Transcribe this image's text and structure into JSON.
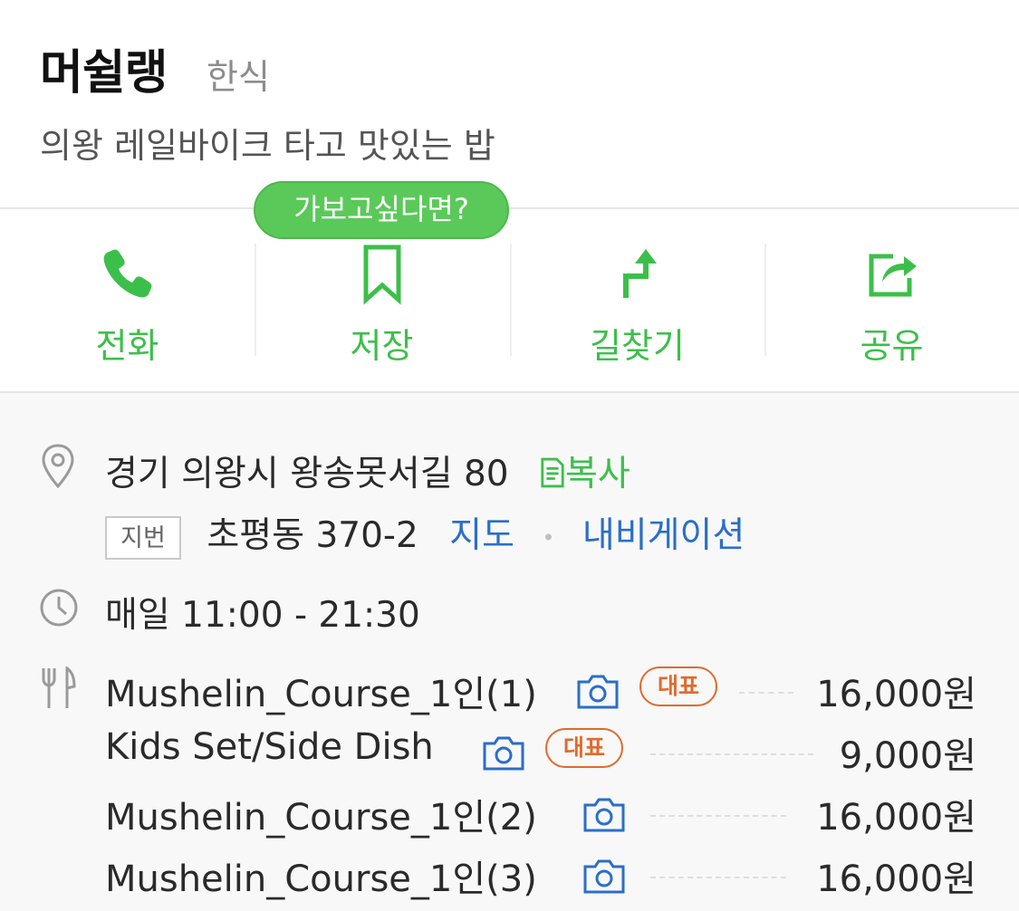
{
  "place": {
    "name": "머쉴랭",
    "category": "한식",
    "description": "의왕 레일바이크 타고 맛있는 밥"
  },
  "colors": {
    "accent": "#3cbf4a",
    "link": "#2a6ec9",
    "badge": "#e06a2c"
  },
  "actions": [
    {
      "label": "전화",
      "icon": "phone-icon"
    },
    {
      "label": "저장",
      "icon": "bookmark-icon"
    },
    {
      "label": "길찾기",
      "icon": "directions-icon"
    },
    {
      "label": "공유",
      "icon": "share-icon"
    }
  ],
  "tooltip": "가보고싶다면?",
  "address": {
    "road": "경기 의왕시 왕송못서길 80",
    "copy_label": "복사",
    "jibun_tag": "지번",
    "jibun": "초평동 370-2",
    "map_link": "지도",
    "nav_link": "내비게이션"
  },
  "hours": "매일 11:00 - 21:30",
  "menu": [
    {
      "name": "Mushelin_Course_1인(1)",
      "badge": "대표",
      "price": "16,000원"
    },
    {
      "name": "Kids Set/Side Dish",
      "badge": "대표",
      "price": "9,000원"
    },
    {
      "name": "Mushelin_Course_1인(2)",
      "badge": "",
      "price": "16,000원"
    },
    {
      "name": "Mushelin_Course_1인(3)",
      "badge": "",
      "price": "16,000원"
    }
  ]
}
